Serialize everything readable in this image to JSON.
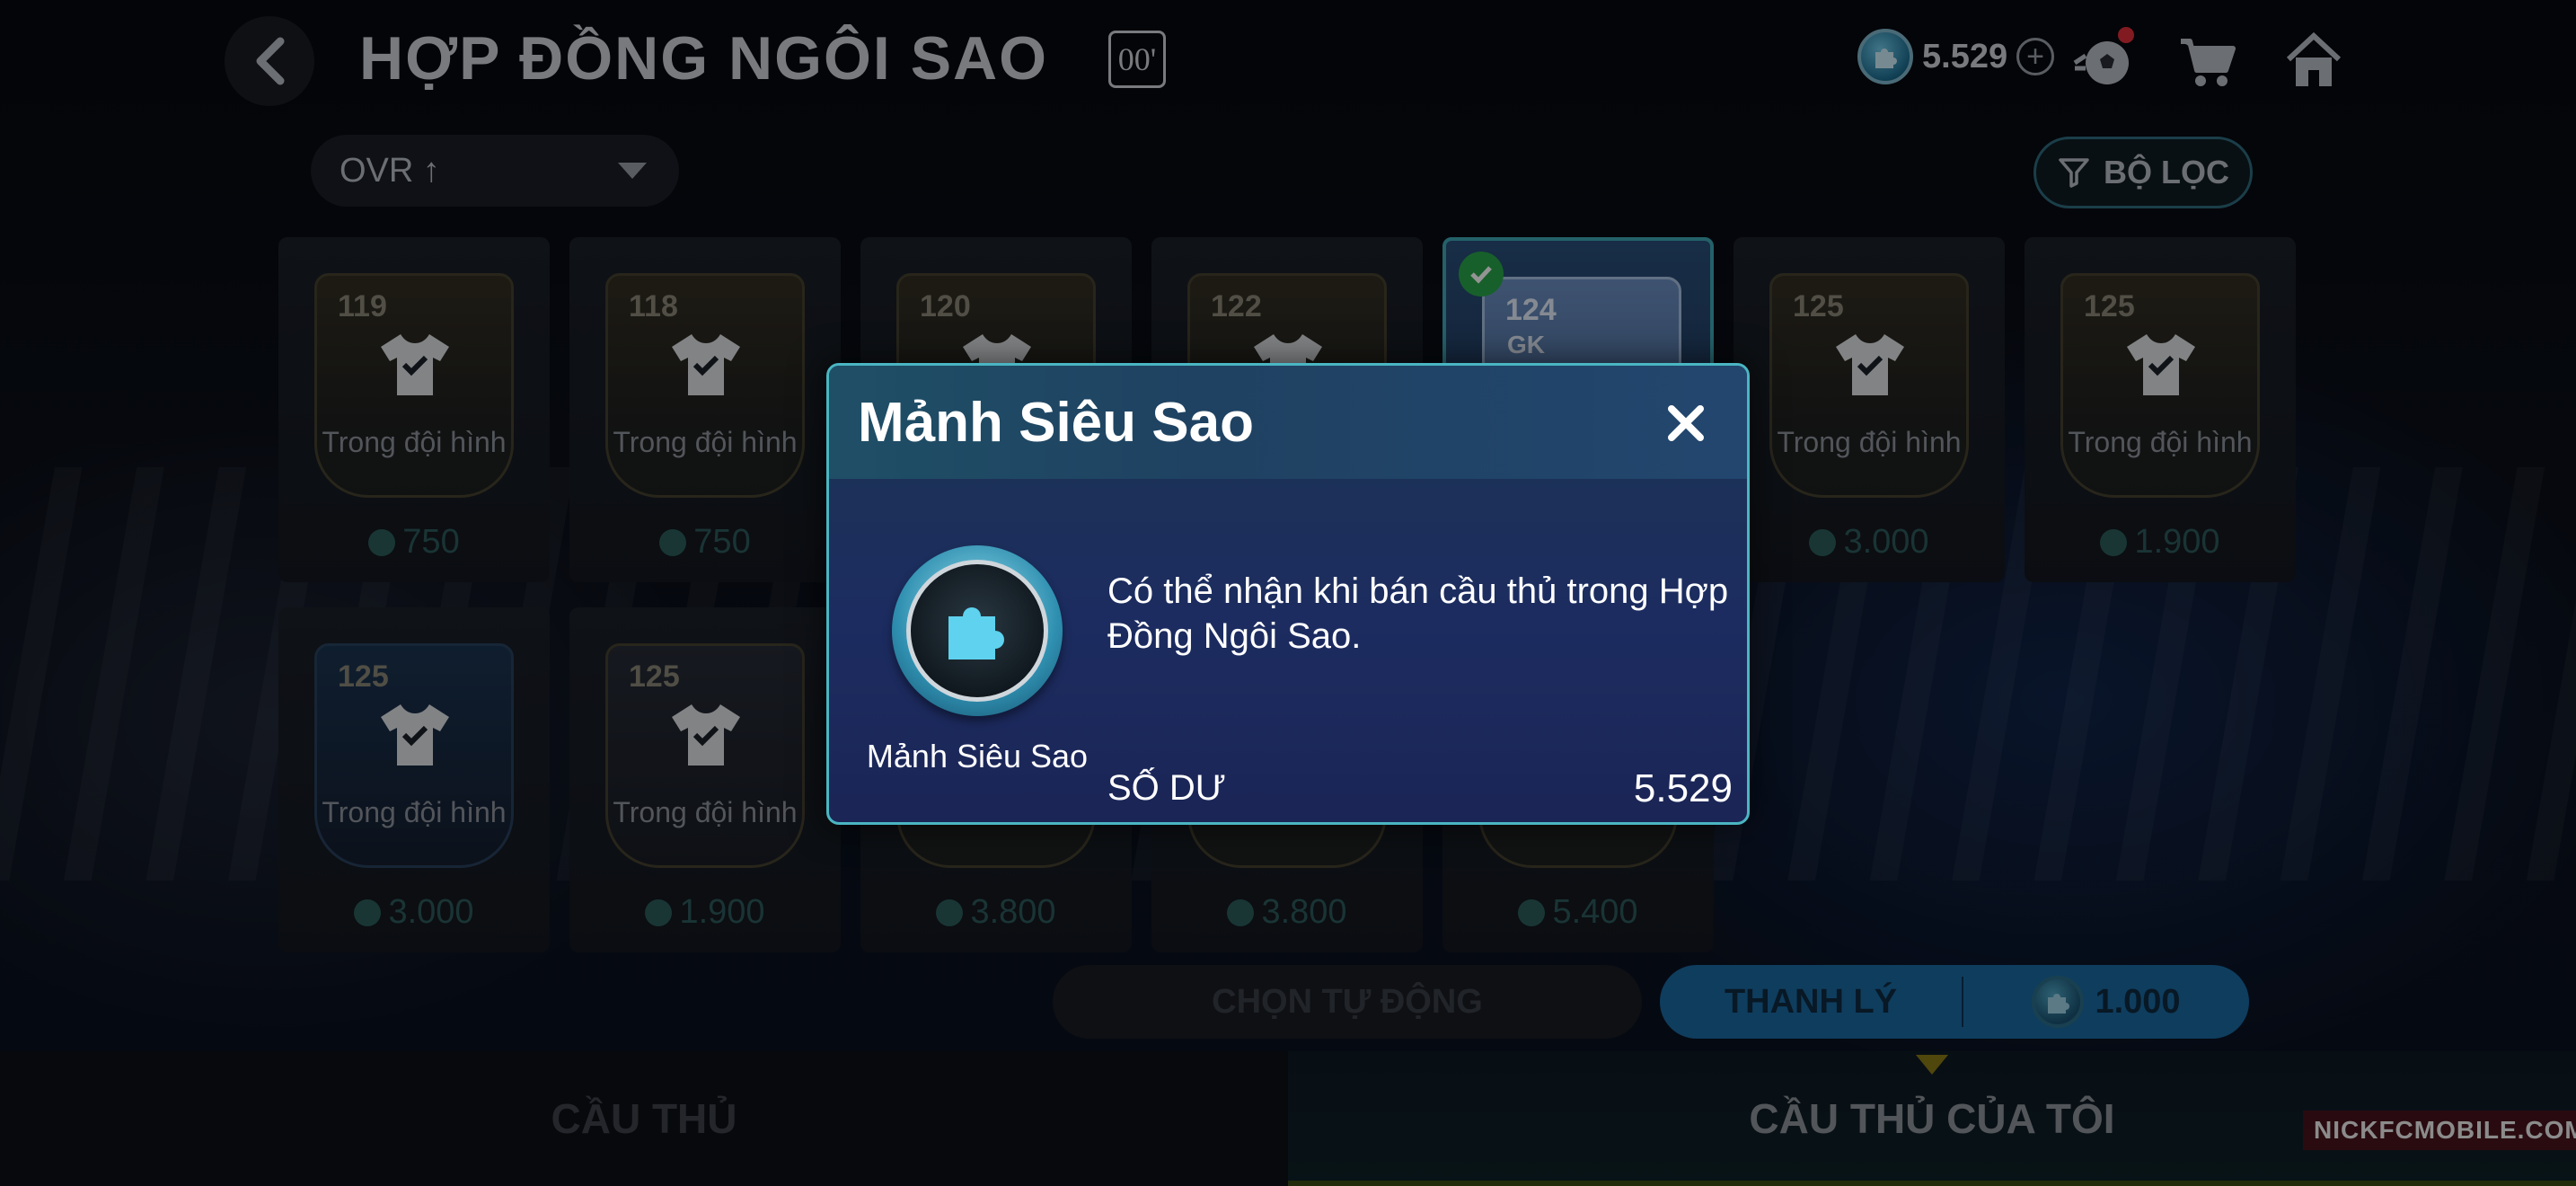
{
  "header": {
    "title": "HỢP ĐỒNG NGÔI SAO",
    "title_badge": "00'",
    "currency_value": "5.529",
    "icons": [
      "back-icon",
      "coin-icon",
      "plus-icon",
      "football-icon",
      "cart-icon",
      "home-icon"
    ]
  },
  "toolbar": {
    "sort_label": "OVR ↑",
    "filter_label": "BỘ LỌC"
  },
  "cards_row1": [
    {
      "ovr": "119",
      "status": "Trong đội hình",
      "price": "750"
    },
    {
      "ovr": "118",
      "status": "Trong đội hình",
      "price": "750"
    },
    {
      "ovr": "120",
      "status": "",
      "price": ""
    },
    {
      "ovr": "122",
      "status": "",
      "price": ""
    },
    {
      "ovr": "124",
      "position": "GK",
      "status": "",
      "price": "",
      "selected": true
    },
    {
      "ovr": "125",
      "status": "Trong đội hình",
      "price": "3.000"
    },
    {
      "ovr": "125",
      "status": "Trong đội hình",
      "price": "1.900"
    }
  ],
  "cards_row2": [
    {
      "ovr": "125",
      "status": "Trong đội hình",
      "price": "3.000"
    },
    {
      "ovr": "125",
      "status": "Trong đội hình",
      "price": "1.900"
    },
    {
      "ovr": "",
      "status": "",
      "price": "3.800"
    },
    {
      "ovr": "",
      "status": "",
      "price": "3.800"
    },
    {
      "ovr": "",
      "status": "",
      "price": "5.400"
    }
  ],
  "actions": {
    "auto_select_label": "CHỌN TỰ ĐỘNG",
    "sell_label": "THANH LÝ",
    "sell_cost": "1.000"
  },
  "tabs": [
    {
      "label": "CẦU THỦ",
      "active": false
    },
    {
      "label": "CẦU THỦ CỦA TÔI",
      "active": true
    }
  ],
  "watermark": "NICKFCMOBILE.COM",
  "modal": {
    "title": "Mảnh Siêu Sao",
    "item_name": "Mảnh Siêu Sao",
    "description": "Có thể nhận khi bán cầu thủ trong Hợp Đồng Ngôi Sao.",
    "balance_label": "SỐ DƯ",
    "balance_value": "5.529"
  },
  "colors": {
    "accent": "#4ab6c2",
    "sell_button": "#1a6aa2",
    "selected_check": "#2aa64b"
  }
}
